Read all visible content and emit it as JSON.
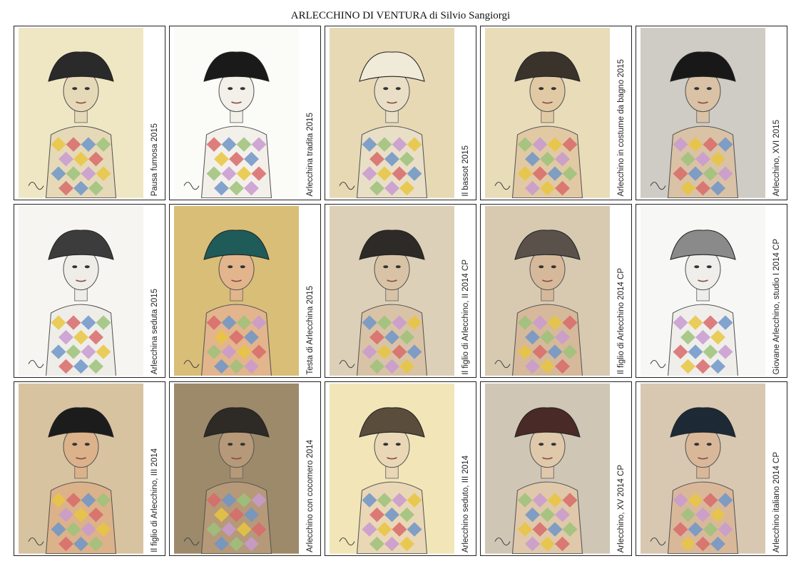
{
  "title": "ARLECCHINO DI VENTURA di Silvio Sangiorgi",
  "artworks": [
    {
      "caption": "Pausa fumosa 2015",
      "bg": "#efe7c4",
      "hat": "#2a2a2a",
      "skin": "#e6d9b8"
    },
    {
      "caption": "Arlecchina tradita 2015",
      "bg": "#fbfbf8",
      "hat": "#1a1a1a",
      "skin": "#f3f0ea"
    },
    {
      "caption": "Il bassot 2015",
      "bg": "#e6d9b4",
      "hat": "#f0ead8",
      "skin": "#e9dfc6"
    },
    {
      "caption": "Arlecchino in costume da bagno 2015",
      "bg": "#e9dcb9",
      "hat": "#3a332c",
      "skin": "#e1c9a4"
    },
    {
      "caption": "Arlecchino, XVI 2015",
      "bg": "#cfcbc5",
      "hat": "#181818",
      "skin": "#d9c2a5"
    },
    {
      "caption": "Arlecchina seduta 2015",
      "bg": "#f6f5f1",
      "hat": "#3c3c3c",
      "skin": "#efede8"
    },
    {
      "caption": "Testa di Arlecchina 2015",
      "bg": "#d9be78",
      "hat": "#1f5b58",
      "skin": "#e2b58c"
    },
    {
      "caption": "Il figlio di Arlecchino, II 2014 CP",
      "bg": "#ddd0b8",
      "hat": "#2d2a27",
      "skin": "#d9c3a6"
    },
    {
      "caption": "Il figlio di Arlecchino 2014 CP",
      "bg": "#d8cab1",
      "hat": "#5a524a",
      "skin": "#d6b99a"
    },
    {
      "caption": "Giovane Arlecchino, studio I 2014 CP",
      "bg": "#f7f7f5",
      "hat": "#8a8a8a",
      "skin": "#efeeeb"
    },
    {
      "caption": "Il figlio di Arlecchino, III 2014",
      "bg": "#d8c3a1",
      "hat": "#1c1c1c",
      "skin": "#dcb28a"
    },
    {
      "caption": "Arlecchino con cocomero 2014",
      "bg": "#9c8a6a",
      "hat": "#2e2a26",
      "skin": "#b69978"
    },
    {
      "caption": "Arlecchino seduto, III 2014",
      "bg": "#f2e6b8",
      "hat": "#5a4d3c",
      "skin": "#ead7b6"
    },
    {
      "caption": "Arlecchino, XV 2014 CP",
      "bg": "#cfc6b5",
      "hat": "#4a2a26",
      "skin": "#e0c8aa"
    },
    {
      "caption": "Arlecchino italiano 2014 CP",
      "bg": "#d8c8b2",
      "hat": "#1d2a36",
      "skin": "#d9b89a"
    }
  ]
}
